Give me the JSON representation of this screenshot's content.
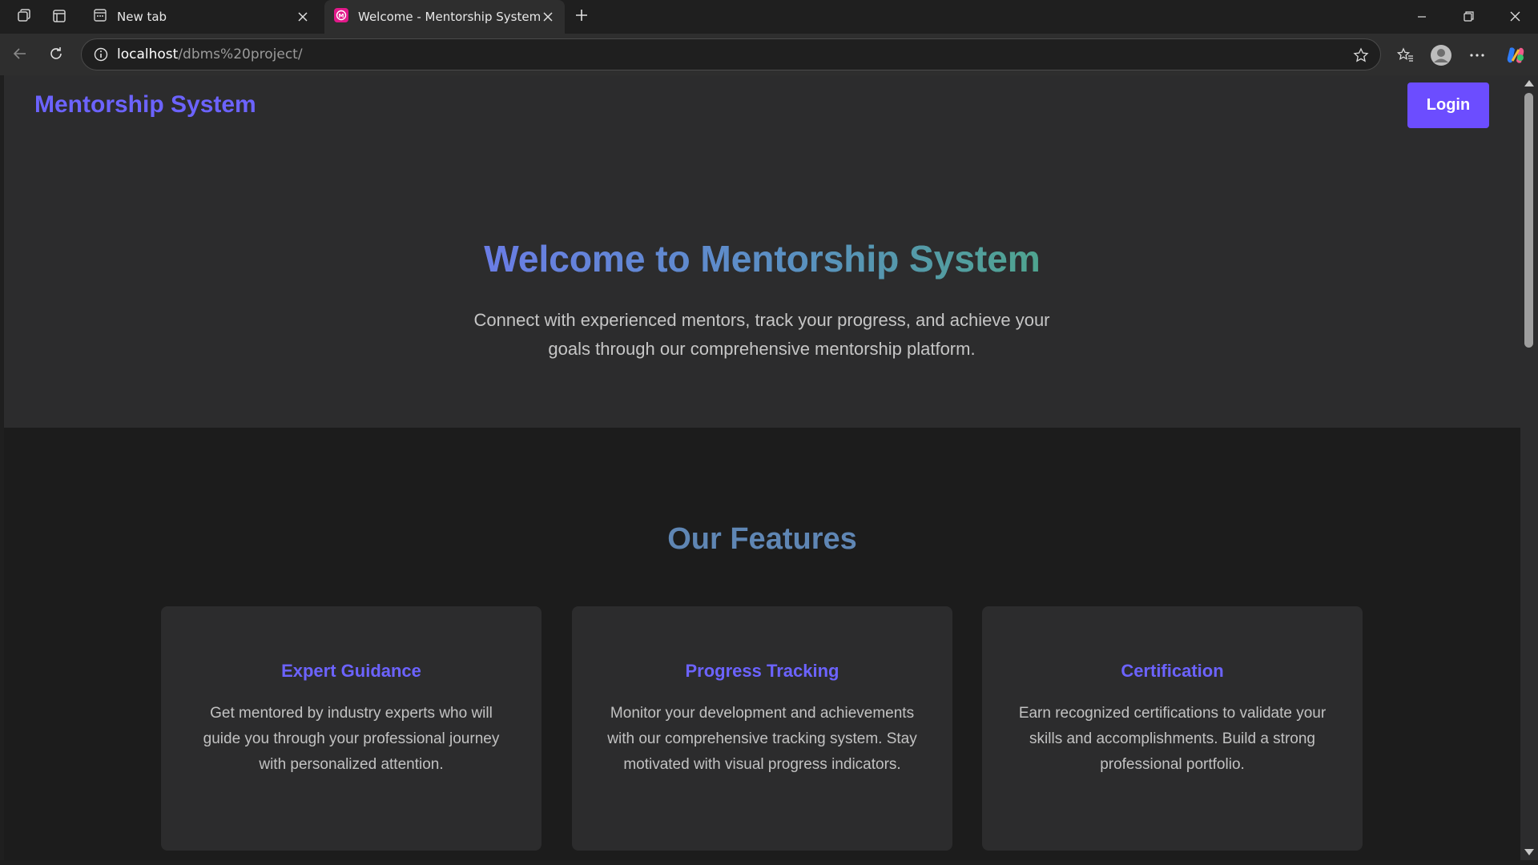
{
  "browser": {
    "tabs": [
      {
        "title": "New tab",
        "icon": "new-tab-page-icon"
      },
      {
        "title": "Welcome - Mentorship System",
        "icon": "site-favicon"
      }
    ],
    "address": {
      "host": "localhost",
      "path": "/dbms%20project/"
    },
    "colors": {
      "chrome": "#1f1f1f",
      "toolbar": "#2e2e2e"
    }
  },
  "page": {
    "brand": "Mentorship System",
    "login_label": "Login",
    "hero": {
      "title": "Welcome to Mentorship System",
      "subtitle": "Connect with experienced mentors, track your progress, and achieve your goals through our comprehensive mentorship platform."
    },
    "features": {
      "title": "Our Features",
      "cards": [
        {
          "title": "Expert Guidance",
          "text": "Get mentored by industry experts who will guide you through your professional journey with personalized attention."
        },
        {
          "title": "Progress Tracking",
          "text": "Monitor your development and achievements with our comprehensive tracking system. Stay motivated with visual progress indicators."
        },
        {
          "title": "Certification",
          "text": "Earn recognized certifications to validate your skills and accomplishments. Build a strong professional portfolio."
        }
      ]
    },
    "colors": {
      "accent": "#6c63ff",
      "button": "#6c4dff",
      "surface": "#2c2c2d",
      "section_dark": "#1c1c1c"
    }
  }
}
